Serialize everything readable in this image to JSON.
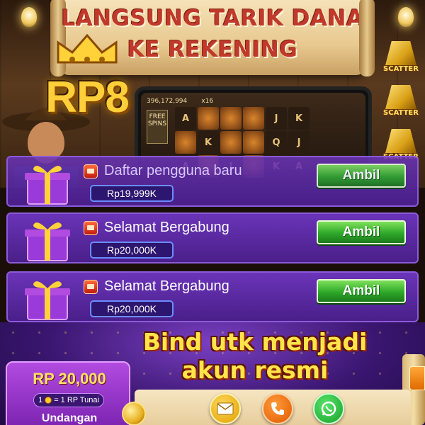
{
  "hero": {
    "banner_line1": "LANGSUNG TARIK DANA",
    "banner_line2": "KE REKENING",
    "logo_text": "RP8",
    "phone_balance": "396,172,994",
    "phone_multiplier": "x16",
    "free_spins_label": "FREE SPINS",
    "scatter_label": "SCATTER"
  },
  "rewards": [
    {
      "title": "Daftar pengguna baru",
      "amount": "Rp19,999K",
      "action": "Ambil"
    },
    {
      "title": "Selamat Bergabung",
      "amount": "Rp20,000K",
      "action": "Ambil"
    },
    {
      "title": "Selamat Bergabung",
      "amount": "Rp20,000K",
      "action": "Ambil"
    }
  ],
  "bind": {
    "line1": "Bind utk menjadi",
    "line2": "akun resmi"
  },
  "invite": {
    "amount": "RP 20,000",
    "rate_left": "1",
    "rate_right": "= 1 RP Tunai",
    "label": "Undangan"
  },
  "contacts": [
    {
      "icon": "mail-icon"
    },
    {
      "icon": "phone-icon"
    },
    {
      "icon": "whatsapp-icon"
    }
  ],
  "colors": {
    "card_purple": "#4a1f8a",
    "ambil_green": "#2ea82a",
    "gold": "#ffe44a"
  }
}
